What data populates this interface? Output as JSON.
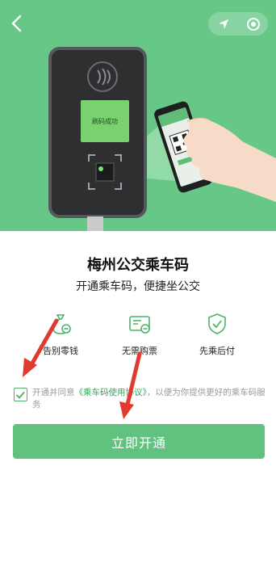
{
  "hero": {
    "screen_text": "刷码成功",
    "back_icon": "chevron-left-icon",
    "location_icon": "location-arrow-icon",
    "target_icon": "target-icon"
  },
  "title": "梅州公交乘车码",
  "subtitle": "开通乘车码，便捷坐公交",
  "features": [
    {
      "icon": "money-bag-icon",
      "label": "告别零钱"
    },
    {
      "icon": "card-icon",
      "label": "无需购票"
    },
    {
      "icon": "shield-check-icon",
      "label": "先乘后付"
    }
  ],
  "agreement": {
    "checked": true,
    "prefix": "开通并同意",
    "link": "《乘车码使用协议》",
    "suffix": "，以便为你提供更好的乘车码服务"
  },
  "open_button": "立即开通",
  "colors": {
    "brand_green": "#61c17f",
    "hero_green": "#66c787",
    "annotation_red": "#e03a2f"
  }
}
